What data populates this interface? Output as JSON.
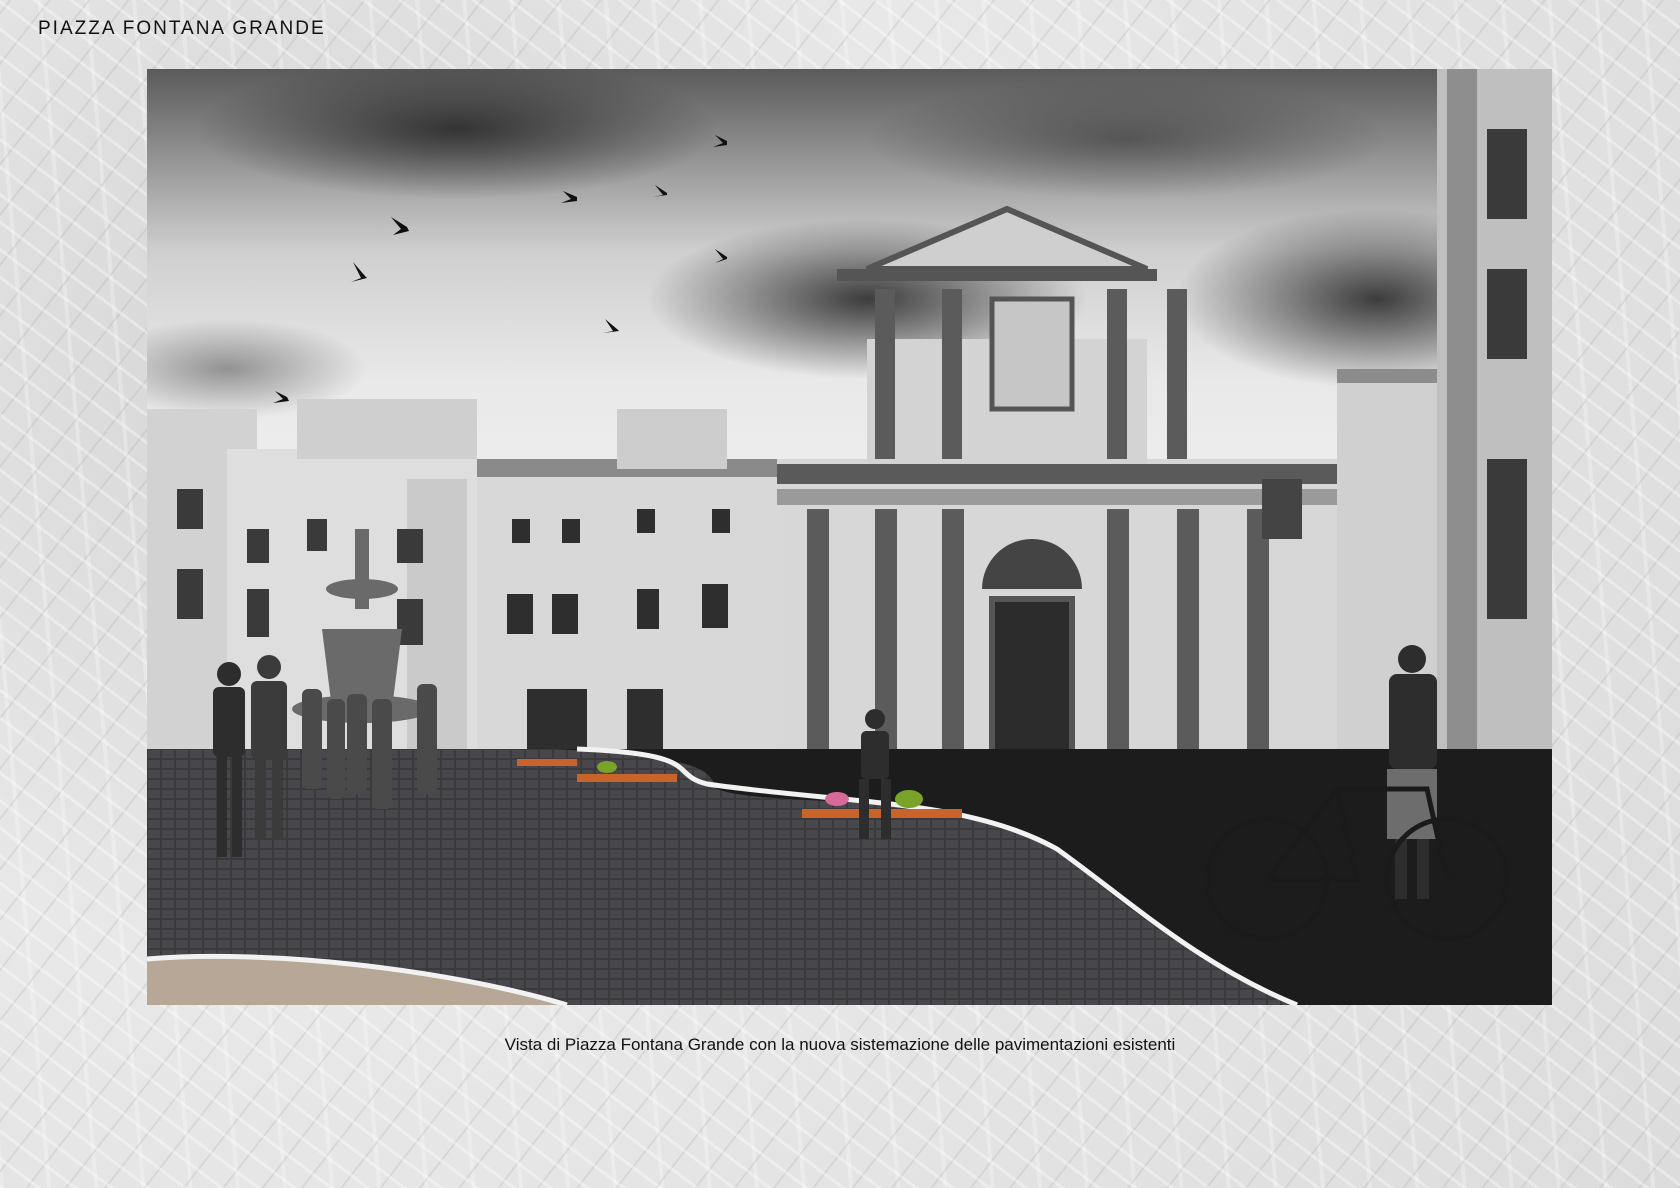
{
  "page": {
    "title": "PIAZZA FONTANA GRANDE",
    "caption": "Vista di Piazza Fontana Grande con la nuova sistemazione delle pavimentazioni esistenti"
  },
  "photo": {
    "accent_colors": {
      "benches": "#c8642a",
      "planters": "#7aa32a",
      "flowers": "#d86a9a"
    }
  }
}
